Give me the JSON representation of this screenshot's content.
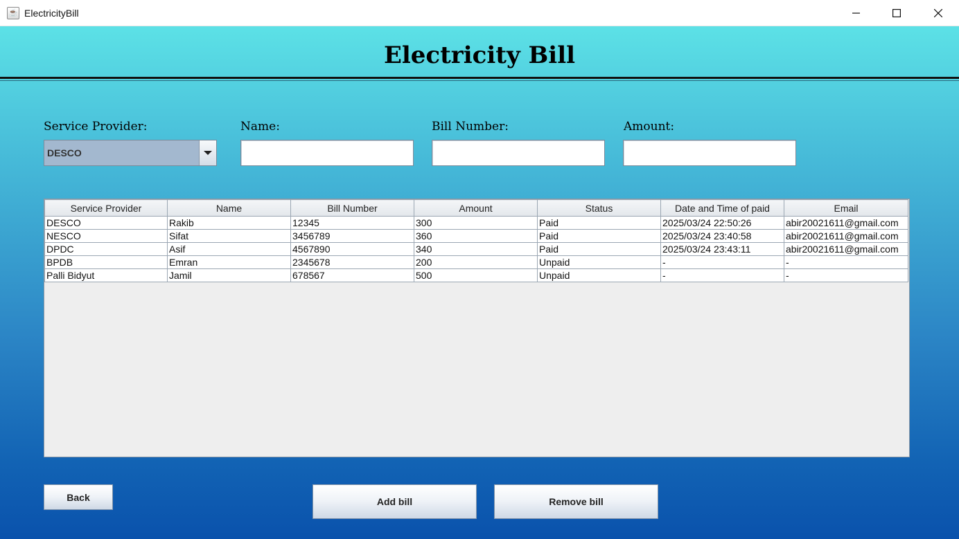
{
  "window": {
    "title": "ElectricityBill",
    "app_icon": "java-cup-icon",
    "controls": [
      "minimize-icon",
      "maximize-icon",
      "close-icon"
    ]
  },
  "header": {
    "title": "Electricity Bill"
  },
  "form": {
    "provider_label": "Service Provider:",
    "provider_value": "DESCO",
    "name_label": "Name:",
    "name_value": "",
    "bill_label": "Bill Number:",
    "bill_value": "",
    "amount_label": "Amount:",
    "amount_value": ""
  },
  "table": {
    "columns": [
      "Service Provider",
      "Name",
      "Bill Number",
      "Amount",
      "Status",
      "Date and Time of paid",
      "Email"
    ],
    "rows": [
      [
        "DESCO",
        "Rakib",
        "12345",
        "300",
        "Paid",
        "2025/03/24 22:50:26",
        "abir20021611@gmail.com"
      ],
      [
        "NESCO",
        "Sifat",
        "3456789",
        "360",
        "Paid",
        "2025/03/24 23:40:58",
        "abir20021611@gmail.com"
      ],
      [
        "DPDC",
        "Asif",
        "4567890",
        "340",
        "Paid",
        "2025/03/24 23:43:11",
        "abir20021611@gmail.com"
      ],
      [
        "BPDB",
        "Emran",
        "2345678",
        "200",
        "Unpaid",
        "-",
        "-"
      ],
      [
        "Palli Bidyut",
        "Jamil",
        "678567",
        "500",
        "Unpaid",
        "-",
        "-"
      ]
    ]
  },
  "buttons": {
    "back": "Back",
    "add": "Add bill",
    "remove": "Remove bill"
  },
  "colors": {
    "gradient_top": "#5ce1e6",
    "gradient_bottom": "#0a52ac",
    "combo_bg": "#a3b8cf"
  }
}
